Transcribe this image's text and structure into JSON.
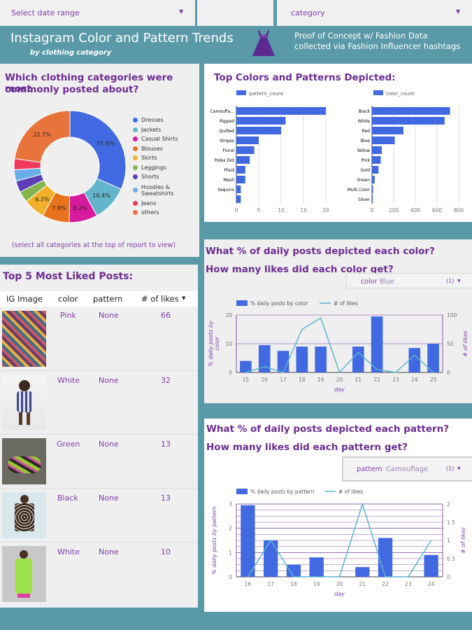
{
  "filters": {
    "date_range": "Select date range",
    "category": "category"
  },
  "header": {
    "title": "Instagram Color and Pattern Trends",
    "subtitle": "by clothing category",
    "note_line1": "Proof of Concept w/ Fashion Data",
    "note_line2": "collected via Fashion Influencer hashtags"
  },
  "categories_panel": {
    "title_line1": "Which clothing categories were most",
    "title_line2": "commonly posted about?",
    "footnote": "(select all categories at the top of report to view)"
  },
  "top_colors_panel": {
    "title": "Top Colors and Patterns Depicted:"
  },
  "posts_panel": {
    "title": "Top 5 Most Liked Posts:",
    "headers": [
      "IG Image",
      "color",
      "pattern",
      "# of likes"
    ],
    "rows": [
      {
        "color": "Pink",
        "pattern": "None",
        "likes": "66"
      },
      {
        "color": "White",
        "pattern": "None",
        "likes": "32"
      },
      {
        "color": "Green",
        "pattern": "None",
        "likes": "13"
      },
      {
        "color": "Black",
        "pattern": "None",
        "likes": "13"
      },
      {
        "color": "White",
        "pattern": "None",
        "likes": "10"
      }
    ]
  },
  "color_daily_panel": {
    "title1": "What % of daily posts depicted each color?",
    "title2": "How many likes did each color get?",
    "filter_label": "color",
    "filter_value": "Blue",
    "filter_count": "(1)"
  },
  "pattern_daily_panel": {
    "title1": "What % of daily posts depicted each pattern?",
    "title2": "How many likes did each pattern get?",
    "filter_label": "pattern",
    "filter_value": "Camouflage",
    "filter_count": "(1)"
  },
  "colors": {
    "teal": "#5a9aa8",
    "purple_title": "#6b2c91",
    "bar_blue": "#4169e1",
    "line_teal": "#5ab4d0"
  },
  "chart_data": [
    {
      "type": "pie",
      "title": "Which clothing categories were most commonly posted about?",
      "labels": [
        "Dresses",
        "Jackets",
        "Casual Shirts",
        "Blouses",
        "Skirts",
        "Leggings",
        "Shorts",
        "Hoodies & Sweatshirts",
        "Jeans",
        "others"
      ],
      "values": [
        31.6,
        10.4,
        8.2,
        7.9,
        6.2,
        3.2,
        3.3,
        3.3,
        3.2,
        22.7
      ],
      "shown_labels": [
        "31.6%",
        "10.4%",
        "8.2%",
        "7.9%",
        "6.2%",
        "22.7%"
      ],
      "colors": [
        "#4169e1",
        "#62b5cb",
        "#d81b9c",
        "#e8731c",
        "#f0b02a",
        "#84b44c",
        "#5c3fb4",
        "#6aaee8",
        "#ef3a5d",
        "#e8743c"
      ]
    },
    {
      "type": "bar",
      "orientation": "horizontal",
      "legend": "pattern_count",
      "categories": [
        "Camoufla...",
        "Ripped",
        "Quilted",
        "Stripes",
        "Floral",
        "Polka Dot",
        "Plaid",
        "Mesh",
        "Sequins",
        ""
      ],
      "values": [
        20,
        11,
        10,
        5,
        4,
        3,
        2,
        2,
        1,
        1
      ],
      "xlim": [
        0,
        20
      ],
      "xticks": [
        "0",
        "5",
        "10",
        "15",
        "20"
      ]
    },
    {
      "type": "bar",
      "orientation": "horizontal",
      "legend": "color_count",
      "categories": [
        "Black",
        "White",
        "Red",
        "Blue",
        "Yellow",
        "Pink",
        "Gold",
        "Green",
        "Multi Color",
        "Silver"
      ],
      "values": [
        720,
        670,
        290,
        210,
        90,
        80,
        60,
        25,
        10,
        8
      ],
      "xlim": [
        0,
        800
      ],
      "xticks": [
        "0",
        "200",
        "400",
        "600",
        "800"
      ]
    },
    {
      "type": "bar",
      "combo": "bar+line",
      "xlabel": "day",
      "ylabel": "% daily posts by color",
      "y2label": "# of likes",
      "x": [
        "15",
        "16",
        "17",
        "18",
        "19",
        "20",
        "21",
        "22",
        "23",
        "24",
        "25"
      ],
      "series": [
        {
          "name": "% daily posts by color",
          "type": "bar",
          "values": [
            4,
            9.5,
            7.5,
            9,
            9,
            0,
            9,
            19.5,
            0,
            8.5,
            10
          ]
        },
        {
          "name": "# of likes",
          "type": "line",
          "axis": "right",
          "values": [
            0,
            10,
            0,
            75,
            95,
            0,
            35,
            5,
            0,
            30,
            0
          ]
        }
      ],
      "ylim": [
        0,
        20
      ],
      "y2lim": [
        0,
        100
      ],
      "yticks": [
        "0",
        "10",
        "20"
      ],
      "y2ticks": [
        "0",
        "50",
        "100"
      ]
    },
    {
      "type": "bar",
      "combo": "bar+line",
      "xlabel": "day",
      "ylabel": "% daily posts by pattern",
      "y2label": "# of likes",
      "x": [
        "16",
        "17",
        "18",
        "19",
        "20",
        "21",
        "22",
        "23",
        "24"
      ],
      "series": [
        {
          "name": "% daily posts by pattern",
          "type": "bar",
          "values": [
            2.95,
            1.5,
            0.5,
            0.8,
            0,
            0.4,
            1.6,
            0,
            0.9
          ]
        },
        {
          "name": "# of likes",
          "type": "line",
          "axis": "right",
          "values": [
            0,
            1,
            0,
            0,
            0,
            2,
            0,
            0,
            1
          ]
        }
      ],
      "ylim": [
        0,
        3
      ],
      "y2lim": [
        0,
        2
      ],
      "yticks": [
        "0",
        "1",
        "2",
        "3"
      ],
      "y2ticks": [
        "0",
        "0.5",
        "1",
        "1.5",
        "2"
      ]
    }
  ]
}
